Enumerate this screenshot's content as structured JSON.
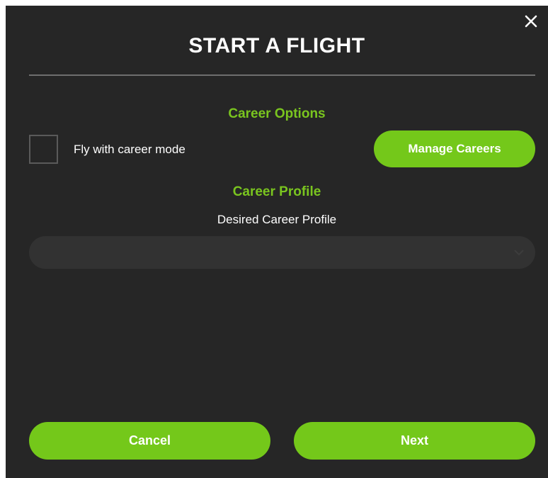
{
  "dialog": {
    "title": "START A FLIGHT",
    "close_icon": "close-icon"
  },
  "career_options": {
    "heading": "Career Options",
    "checkbox_label": "Fly with career mode",
    "checkbox_checked": false,
    "manage_button_label": "Manage Careers"
  },
  "career_profile": {
    "heading": "Career Profile",
    "field_label": "Desired Career Profile",
    "selected_value": "",
    "dropdown_icon": "chevron-down-icon"
  },
  "footer": {
    "cancel_label": "Cancel",
    "next_label": "Next"
  },
  "colors": {
    "background": "#262626",
    "accent": "#74c81a",
    "heading_green": "#7ac51f",
    "divider": "#6e6e6e",
    "select_bg": "#323232"
  }
}
